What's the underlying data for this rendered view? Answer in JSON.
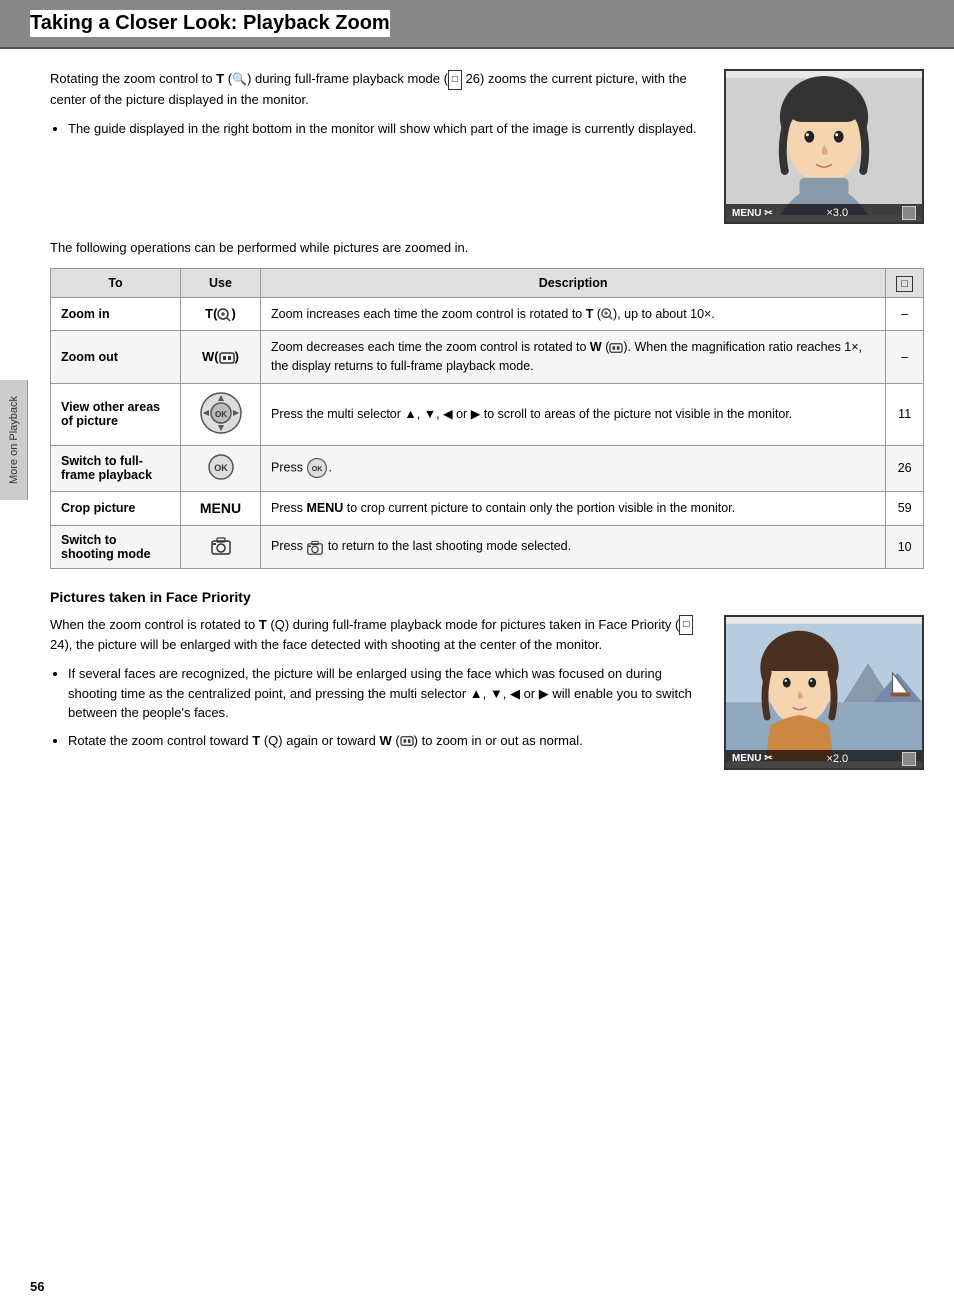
{
  "header": {
    "title": "Taking a Closer Look: Playback Zoom",
    "bg_color": "#888"
  },
  "intro": {
    "paragraph": "Rotating the zoom control to T (🔍) during full-frame playback mode (🔲 26) zooms the current picture, with the center of the picture displayed in the monitor.",
    "bullet": "The guide displayed in the right bottom in the monitor will show which part of the image is currently displayed.",
    "operations_note": "The following operations can be performed while pictures are zoomed in."
  },
  "table": {
    "headers": [
      "To",
      "Use",
      "Description",
      "📖"
    ],
    "rows": [
      {
        "to": "Zoom in",
        "use": "T(🔍)",
        "use_type": "text",
        "description": "Zoom increases each time the zoom control is rotated to T (🔍), up to about 10×.",
        "ref": "–"
      },
      {
        "to": "Zoom out",
        "use": "W(🔲)",
        "use_type": "text",
        "description": "Zoom decreases each time the zoom control is rotated to W (🔲). When the magnification ratio reaches 1×, the display returns to full-frame playback mode.",
        "ref": "–"
      },
      {
        "to": "View other areas of picture",
        "use": "multi_selector",
        "use_type": "icon",
        "description": "Press the multi selector ▲, ▼, ◀ or ▶ to scroll to areas of the picture not visible in the monitor.",
        "ref": "11"
      },
      {
        "to": "Switch to full-frame playback",
        "use": "OK",
        "use_type": "circle",
        "description": "Press 🆗.",
        "ref": "26"
      },
      {
        "to": "Crop picture",
        "use": "MENU",
        "use_type": "bold_text",
        "description": "Press MENU to crop current picture to contain only the portion visible in the monitor.",
        "ref": "59"
      },
      {
        "to": "Switch to shooting mode",
        "use": "📷",
        "use_type": "camera",
        "description": "Press 📷 to return to the last shooting mode selected.",
        "ref": "10"
      }
    ]
  },
  "face_priority": {
    "title": "Pictures taken in Face Priority",
    "paragraph1": "When the zoom control is rotated to T (Q) during full-frame playback mode for pictures taken in Face Priority (🔲 24), the picture will be enlarged with the face detected with shooting at the center of the monitor.",
    "bullets": [
      "If several faces are recognized, the picture will be enlarged using the face which was focused on during shooting time as the centralized point, and pressing the multi selector ▲, ▼, ◀ or ▶ will enable you to switch between the people's faces.",
      "Rotate the zoom control toward T (Q) again or toward W (🔲) to zoom in or out as normal."
    ]
  },
  "sidebar": {
    "label": "More on Playback"
  },
  "page_number": "56"
}
